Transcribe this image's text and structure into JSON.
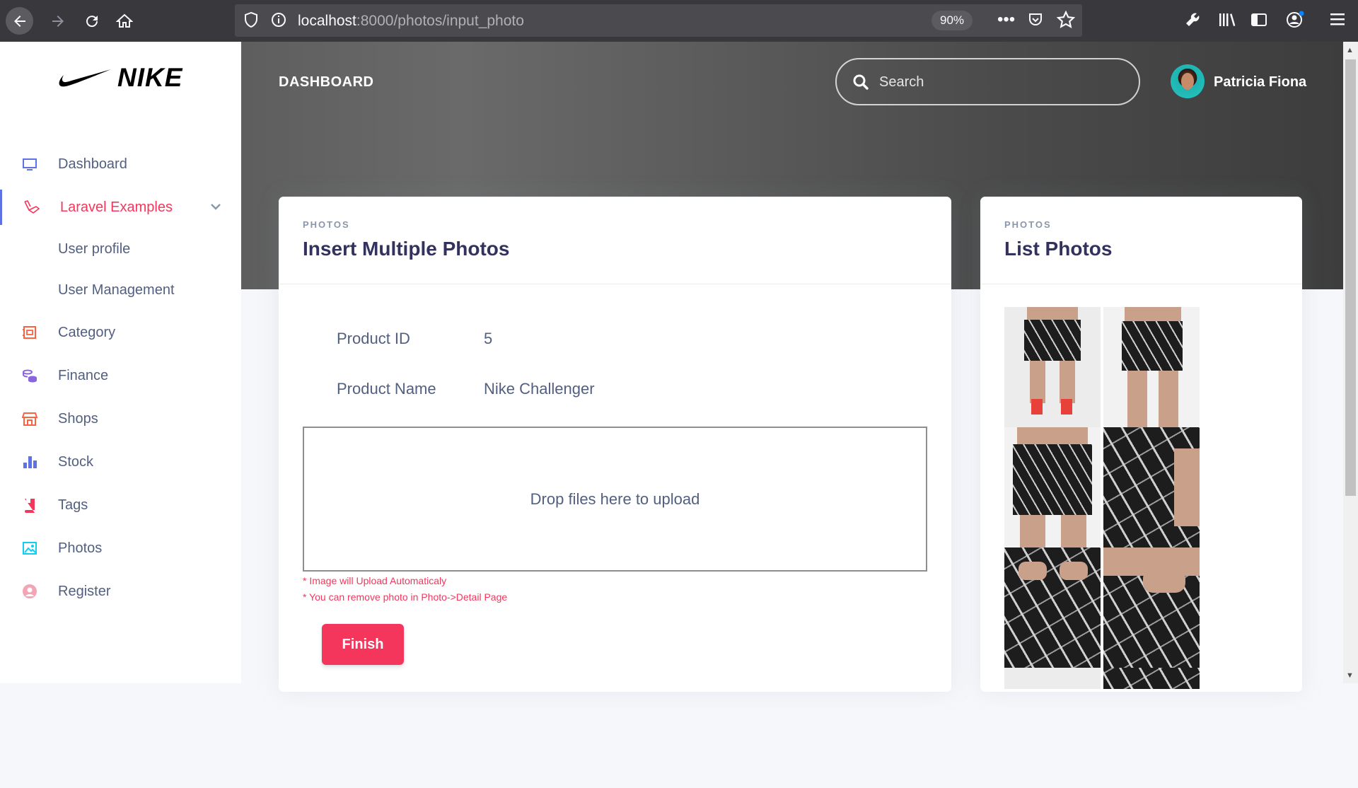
{
  "browser": {
    "url_host": "localhost",
    "url_path": ":8000/photos/input_photo",
    "zoom": "90%"
  },
  "sidebar": {
    "logo_text": "NIKE",
    "items": [
      {
        "label": "Dashboard",
        "icon": "monitor-icon",
        "color": "#5e72e4"
      },
      {
        "label": "Laravel Examples",
        "icon": "laravel-icon",
        "color": "#f5365c",
        "active": true,
        "expanded": true
      },
      {
        "label": "Category",
        "icon": "category-icon",
        "color": "#fb6340"
      },
      {
        "label": "Finance",
        "icon": "finance-icon",
        "color": "#8965e0"
      },
      {
        "label": "Shops",
        "icon": "shop-icon",
        "color": "#fb6340"
      },
      {
        "label": "Stock",
        "icon": "chart-bar-icon",
        "color": "#5e72e4"
      },
      {
        "label": "Tags",
        "icon": "book-icon",
        "color": "#f5365c"
      },
      {
        "label": "Photos",
        "icon": "image-icon",
        "color": "#11cdef"
      },
      {
        "label": "Register",
        "icon": "user-circle-icon",
        "color": "#f3a4b5"
      }
    ],
    "subitems": [
      {
        "label": "User profile"
      },
      {
        "label": "User Management"
      }
    ]
  },
  "header": {
    "title": "DASHBOARD",
    "search_placeholder": "Search",
    "user_name": "Patricia Fiona"
  },
  "insert_card": {
    "eyebrow": "PHOTOS",
    "title": "Insert Multiple Photos",
    "product_id_label": "Product ID",
    "product_id_value": "5",
    "product_name_label": "Product Name",
    "product_name_value": "Nike Challenger",
    "dropzone_text": "Drop files here to upload",
    "note1": "* Image will Upload Automaticaly",
    "note2": "* You can remove photo in Photo->Detail Page",
    "finish_label": "Finish"
  },
  "list_card": {
    "eyebrow": "PHOTOS",
    "title": "List Photos"
  },
  "colors": {
    "primary": "#5e72e4",
    "danger": "#f5365c",
    "heading": "#32325d",
    "text": "#525f7f"
  }
}
